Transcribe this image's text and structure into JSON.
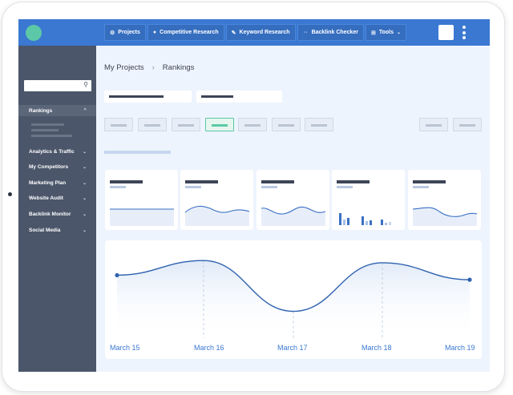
{
  "topbar": {
    "nav": [
      {
        "label": "Projects",
        "icon": "gear-icon"
      },
      {
        "label": "Competitive Research",
        "icon": "target-icon"
      },
      {
        "label": "Keyword Research",
        "icon": "pen-icon"
      },
      {
        "label": "Backlink Checker",
        "icon": "link-icon"
      },
      {
        "label": "Tools",
        "icon": "grid-icon"
      }
    ]
  },
  "sidebar": {
    "items": [
      {
        "label": "Rankings"
      },
      {
        "label": "Analytics & Traffic"
      },
      {
        "label": "My Competitors"
      },
      {
        "label": "Marketing Plan"
      },
      {
        "label": "Website Audit"
      },
      {
        "label": "Backlink Monitor"
      },
      {
        "label": "Social Media"
      }
    ]
  },
  "breadcrumb": {
    "root": "My Projects",
    "separator": "›",
    "current": "Rankings"
  },
  "chart_data": {
    "type": "line",
    "categories": [
      "March 15",
      "March 16",
      "March 17",
      "March 18",
      "March 19"
    ],
    "values": [
      72,
      85,
      40,
      83,
      68
    ],
    "ylim": [
      0,
      100
    ],
    "grid": false
  },
  "colors": {
    "accent": "#3a78d1",
    "highlight": "#5cc8a7",
    "sidebar": "#4b566a"
  }
}
